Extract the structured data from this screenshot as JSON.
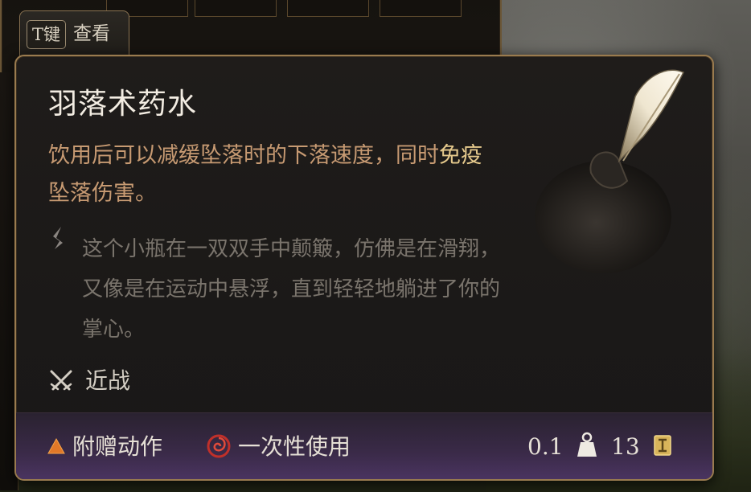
{
  "hotkey": {
    "key": "T键",
    "label": "查看"
  },
  "tooltip": {
    "title": "羽落术药水",
    "description": {
      "part1": "饮用后可以减缓坠落时的下落速度，同时",
      "highlight": "免疫",
      "part2": "坠落伤害。"
    },
    "lore": "这个小瓶在一双双手中颠簸，仿佛是在滑翔，又像是在运动中悬浮，直到轻轻地躺进了你的掌心。",
    "attack_type": "近战",
    "footer": {
      "action_type": "附赠动作",
      "usage": "一次性使用",
      "weight": "0.1",
      "price": "13"
    }
  },
  "icons": {
    "lore": "quill-stroke-icon",
    "melee": "crossed-swords-icon",
    "bonus_action": "orange-triangle-icon",
    "single_use": "red-spiral-icon",
    "weight": "weight-icon",
    "price": "gold-coin-icon",
    "item": "feather-potion-icon"
  },
  "colors": {
    "title": "#f2ece2",
    "description": "#c79a72",
    "highlight": "#e5c98c",
    "lore": "#7a746c",
    "border": "#9a7b4f",
    "footer": "#3a2a48"
  }
}
